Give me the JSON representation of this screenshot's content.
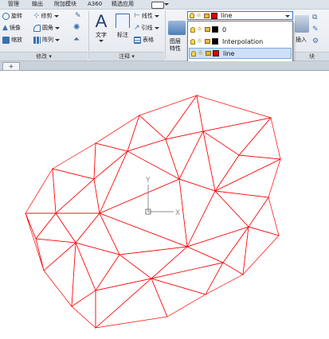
{
  "menubar": {
    "items": [
      "管理",
      "输出",
      "附加模块",
      "A360",
      "精选应用"
    ]
  },
  "ribbon": {
    "modify": {
      "rotate": "旋转",
      "trim": "修剪",
      "mirror": "镜像",
      "fillet": "圆角",
      "scale": "缩放",
      "array": "阵列",
      "title": "修改"
    },
    "annotation": {
      "text": "文字",
      "dimension": "标注",
      "linear": "线性",
      "leader": "引线",
      "table": "表格",
      "title": "注释"
    },
    "layers": {
      "properties": "图层特性"
    },
    "block": {
      "insert": "插入",
      "title": "块"
    }
  },
  "layer_combo": {
    "current": "line",
    "current_color": "#e00000"
  },
  "layer_list": [
    {
      "name": "0",
      "color": "#000000",
      "selected": false
    },
    {
      "name": "Interpolation",
      "color": "#000000",
      "selected": false
    },
    {
      "name": "line",
      "color": "#e00000",
      "selected": true
    },
    {
      "name": "point",
      "color": "#e000e0",
      "selected": false
    }
  ],
  "tabstrip": {
    "plus": "+"
  },
  "canvas": {
    "ucs": {
      "x_label": "X",
      "y_label": "Y"
    },
    "mesh_color": "#ff0000"
  }
}
